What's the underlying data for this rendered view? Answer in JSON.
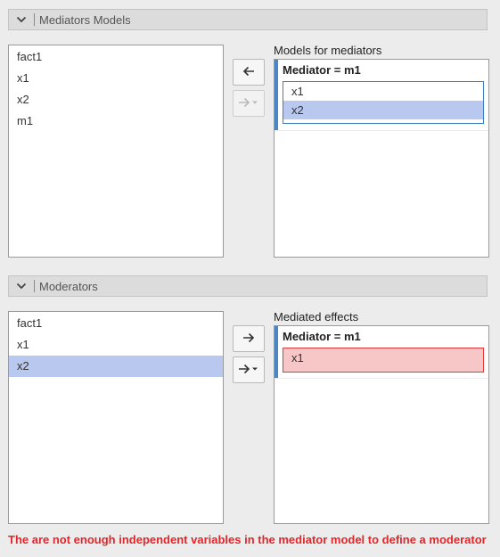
{
  "mediators_section": {
    "title": "Mediators Models",
    "available": [
      "fact1",
      "x1",
      "x2",
      "m1"
    ],
    "target_label": "Models for mediators",
    "group_title": "Mediator = m1",
    "group_items": [
      "x1",
      "x2"
    ]
  },
  "moderators_section": {
    "title": "Moderators",
    "available": [
      "fact1",
      "x1",
      "x2"
    ],
    "target_label": "Mediated effects",
    "group_title": "Mediator = m1",
    "group_items": [
      "x1"
    ]
  },
  "error_message": "The are not enough independent variables in the mediator model to define a moderator",
  "colors": {
    "accent": "#4a86c5",
    "selection": "#b8c8ee",
    "error": "#e3262a"
  },
  "icons": {
    "collapse": "chevron-down-icon",
    "move_left": "arrow-left-icon",
    "move_right": "arrow-right-icon",
    "move_right_dropdown": "arrow-right-dropdown-icon"
  }
}
